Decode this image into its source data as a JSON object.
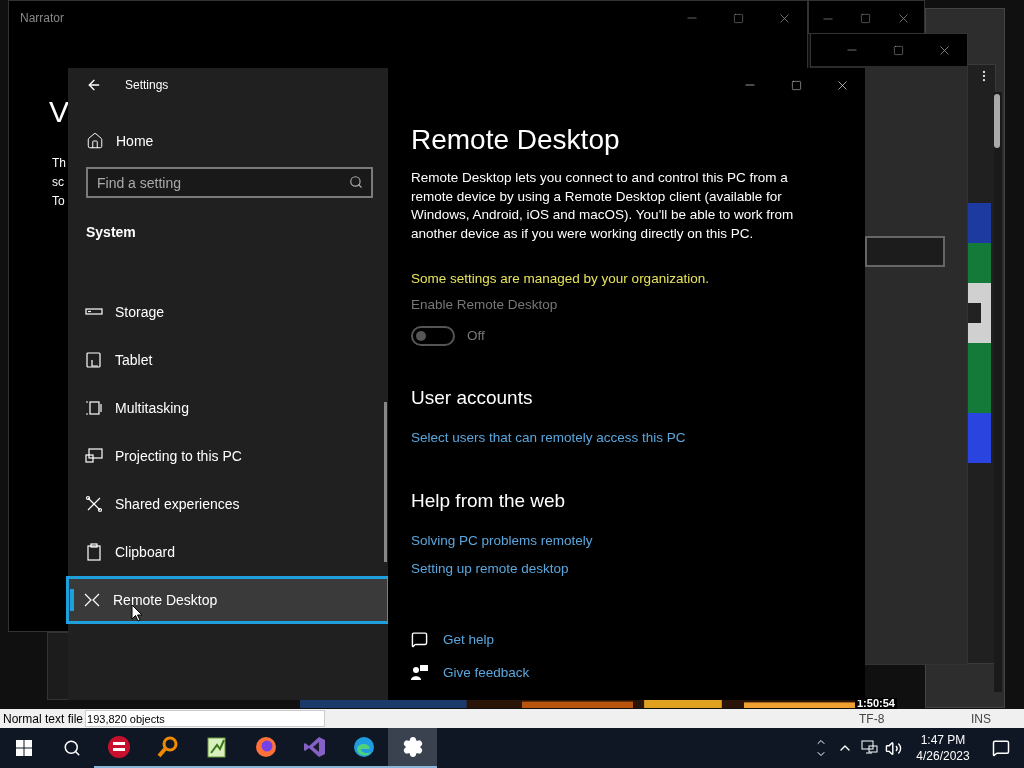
{
  "narrator": {
    "title": "Narrator",
    "heading": "V",
    "text_lines": [
      "Th",
      "sc",
      "To"
    ]
  },
  "video_time": "1:50:54",
  "status_bar": {
    "file_type": "Normal text file",
    "objects": "193,820 objects",
    "encoding": "TF-8",
    "mode": "INS"
  },
  "settings": {
    "title": "Settings",
    "home": "Home",
    "search": {
      "placeholder": "Find a setting"
    },
    "section": "System",
    "nav": [
      {
        "label": "Storage",
        "kind": "storage",
        "selected": false
      },
      {
        "label": "Tablet",
        "kind": "tablet",
        "selected": false
      },
      {
        "label": "Multitasking",
        "kind": "multitasking",
        "selected": false
      },
      {
        "label": "Projecting to this PC",
        "kind": "projecting",
        "selected": false
      },
      {
        "label": "Shared experiences",
        "kind": "shared",
        "selected": false
      },
      {
        "label": "Clipboard",
        "kind": "clipboard",
        "selected": false
      },
      {
        "label": "Remote Desktop",
        "kind": "remote",
        "selected": true
      }
    ],
    "page": {
      "title": "Remote Desktop",
      "description": "Remote Desktop lets you connect to and control this PC from a remote device by using a Remote Desktop client (available for Windows, Android, iOS and macOS). You'll be able to work from another device as if you were working directly on this PC.",
      "policy_notice": "Some settings are managed by your organization.",
      "toggle": {
        "label": "Enable Remote Desktop",
        "on": false,
        "disabled": true,
        "state_text": "Off"
      },
      "user_accounts": {
        "heading": "User accounts",
        "link": "Select users that can remotely access this PC"
      },
      "help": {
        "heading": "Help from the web",
        "links": [
          "Solving PC problems remotely",
          "Setting up remote desktop"
        ]
      },
      "footer_links": [
        {
          "label": "Get help",
          "kind": "help"
        },
        {
          "label": "Give feedback",
          "kind": "feedback"
        }
      ]
    }
  },
  "taskbar": {
    "apps": [
      {
        "kind": "devcpp",
        "active": false
      },
      {
        "kind": "magnifier",
        "active": false
      },
      {
        "kind": "notepad",
        "active": false
      },
      {
        "kind": "firefox",
        "active": false
      },
      {
        "kind": "visualstudio",
        "active": false
      },
      {
        "kind": "edge",
        "active": false
      },
      {
        "kind": "settings",
        "active": true
      }
    ],
    "time": "1:47 PM",
    "date": "4/26/2023"
  }
}
